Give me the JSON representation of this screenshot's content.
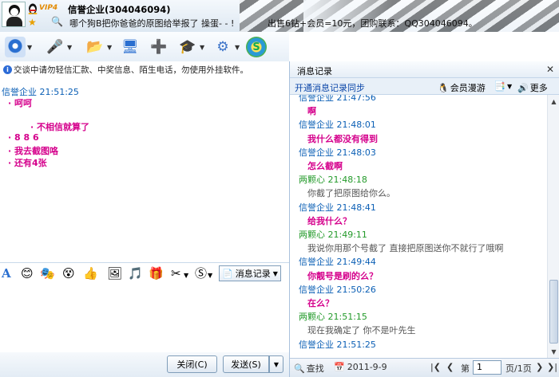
{
  "header": {
    "vip": "VIP4",
    "contact_name": "信誉企业(304046094)",
    "signature": "哪个狗B把你爸爸的原图给举报了 操蛋- - !",
    "ad_text": "出售6钻+会员=10元，团购联系：QQ304046094。"
  },
  "notice": "交谈中请勿轻信汇款、中奖信息、陌生电话，勿使用外挂软件。",
  "chat": {
    "header": "信誉企业   21:51:25",
    "lines": [
      "呵呵",
      "不相信就算了",
      "8 8 6",
      "我去截图咯",
      "还有4张"
    ]
  },
  "input_toolbar": {
    "message_record_label": "消息记录"
  },
  "buttons": {
    "close": "关闭(C)",
    "send": "发送(S)"
  },
  "panel": {
    "title": "消息记录",
    "sync": "开通消息记录同步",
    "vip_roam": "会员漫游",
    "more": "更多",
    "search": "查找",
    "date": "2011-9-9",
    "page_prefix": "第",
    "page_value": "1",
    "page_suffix": "页/1页"
  },
  "history": [
    {
      "sender": "信誉企业",
      "time": "21:47:56",
      "text": "啊",
      "self": true
    },
    {
      "sender": "信誉企业",
      "time": "21:48:01",
      "text": "我什么都没有得到",
      "self": true
    },
    {
      "sender": "信誉企业",
      "time": "21:48:03",
      "text": "怎么截啊",
      "self": true
    },
    {
      "sender": "两颗心",
      "time": "21:48:18",
      "text": "你截了把原图给你么。",
      "self": false
    },
    {
      "sender": "信誉企业",
      "time": "21:48:41",
      "text": "给我什么？",
      "self": true
    },
    {
      "sender": "两颗心",
      "time": "21:49:11",
      "text": "我说你用那个号截了  直接把原图送你不就行了哦啊",
      "self": false
    },
    {
      "sender": "信誉企业",
      "time": "21:49:44",
      "text": "你靓号是刷的么？",
      "self": true
    },
    {
      "sender": "信誉企业",
      "time": "21:50:26",
      "text": "在么？",
      "self": true
    },
    {
      "sender": "两颗心",
      "time": "21:51:15",
      "text": "现在我确定了  你不是叶先生",
      "self": false
    },
    {
      "sender": "信誉企业",
      "time": "21:51:25",
      "text": "",
      "self": true
    }
  ]
}
